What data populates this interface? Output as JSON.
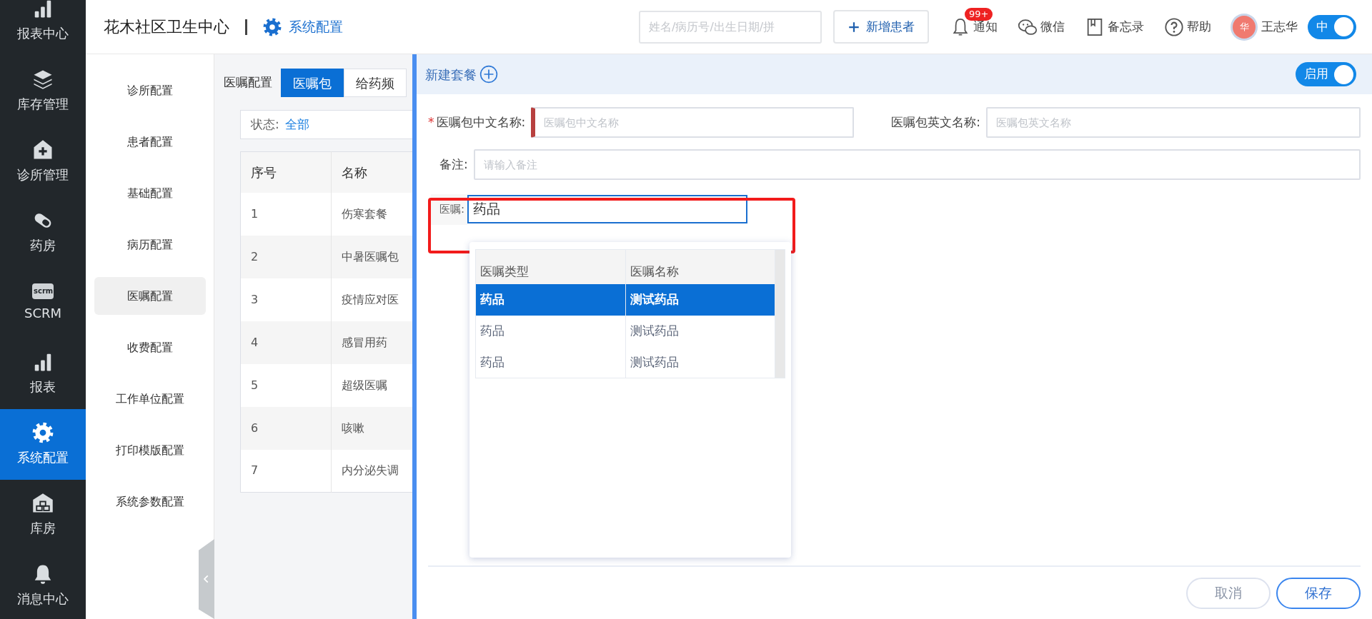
{
  "sidebar": {
    "items": [
      {
        "label": "报表中心",
        "kind": "bars",
        "selected": false
      },
      {
        "label": "库存管理",
        "kind": "layers",
        "selected": false
      },
      {
        "label": "诊所管理",
        "kind": "house-plus",
        "selected": false
      },
      {
        "label": "药房",
        "kind": "pill",
        "selected": false
      },
      {
        "label": "SCRM",
        "kind": "tag",
        "tag": "scrm",
        "selected": false
      },
      {
        "label": "报表",
        "kind": "bars",
        "selected": false
      },
      {
        "label": "系统配置",
        "kind": "gear",
        "selected": true
      },
      {
        "label": "库房",
        "kind": "warehouse",
        "selected": false
      },
      {
        "label": "消息中心",
        "kind": "bell",
        "selected": false
      }
    ]
  },
  "header": {
    "title": "花木社区卫生中心",
    "section": "系统配置",
    "search": {
      "placeholder": "姓名/病历号/出生日期/拼"
    },
    "add_button": "新增患者",
    "actions": [
      {
        "kind": "bell",
        "label": "通知",
        "badge": "99+"
      },
      {
        "kind": "chat",
        "label": "微信"
      },
      {
        "kind": "book",
        "label": "备忘录"
      },
      {
        "kind": "help",
        "label": "帮助"
      }
    ],
    "user": {
      "avatar": "华",
      "name": "王志华"
    },
    "toggle": {
      "label": "中",
      "on": true
    }
  },
  "config_menu": [
    {
      "label": "诊所配置",
      "selected": false
    },
    {
      "label": "患者配置",
      "selected": false
    },
    {
      "label": "基础配置",
      "selected": false
    },
    {
      "label": "病历配置",
      "selected": false
    },
    {
      "label": "医嘱配置",
      "selected": true
    },
    {
      "label": "收费配置",
      "selected": false
    },
    {
      "label": "工作单位配置",
      "selected": false
    },
    {
      "label": "打印模版配置",
      "selected": false
    },
    {
      "label": "系统参数配置",
      "selected": false
    }
  ],
  "content": {
    "label": "医嘱配置",
    "tabs": [
      {
        "label": "医嘱包",
        "selected": true
      },
      {
        "label": "给药频",
        "selected": false
      }
    ],
    "filter": {
      "label": "状态:",
      "value": "全部"
    },
    "table": {
      "columns": [
        "序号",
        "名称"
      ],
      "rows": [
        [
          "1",
          "伤寒套餐"
        ],
        [
          "2",
          "中暑医嘱包"
        ],
        [
          "3",
          "疫情应对医"
        ],
        [
          "4",
          "感冒用药"
        ],
        [
          "5",
          "超级医嘱"
        ],
        [
          "6",
          "咳嗽"
        ],
        [
          "7",
          "内分泌失调"
        ]
      ]
    }
  },
  "panel": {
    "title": "新建套餐",
    "toggle": {
      "label": "启用",
      "on": true
    },
    "name_fields": [
      {
        "label": "医嘱包中文名称:",
        "required_mark": "*",
        "invalid": true,
        "placeholder": "医嘱包中文名称"
      },
      {
        "label": "医嘱包英文名称:",
        "invalid": false,
        "placeholder": "医嘱包英文名称"
      }
    ],
    "remark": {
      "label": "备注:",
      "placeholder": "请输入备注"
    },
    "order": {
      "label": "医嘱:",
      "value": "药品",
      "highlighted": true
    },
    "suggestions": {
      "columns": [
        "医嘱类型",
        "医嘱名称"
      ],
      "rows": [
        {
          "cells": [
            "药品",
            "测试药品"
          ],
          "selected": true
        },
        {
          "cells": [
            "药品",
            "测试药品"
          ],
          "selected": false
        },
        {
          "cells": [
            "药品",
            "测试药品"
          ],
          "selected": false
        }
      ]
    },
    "buttons": [
      {
        "label": "取消",
        "kind": "secondary"
      },
      {
        "label": "保存",
        "kind": "primary"
      }
    ]
  }
}
